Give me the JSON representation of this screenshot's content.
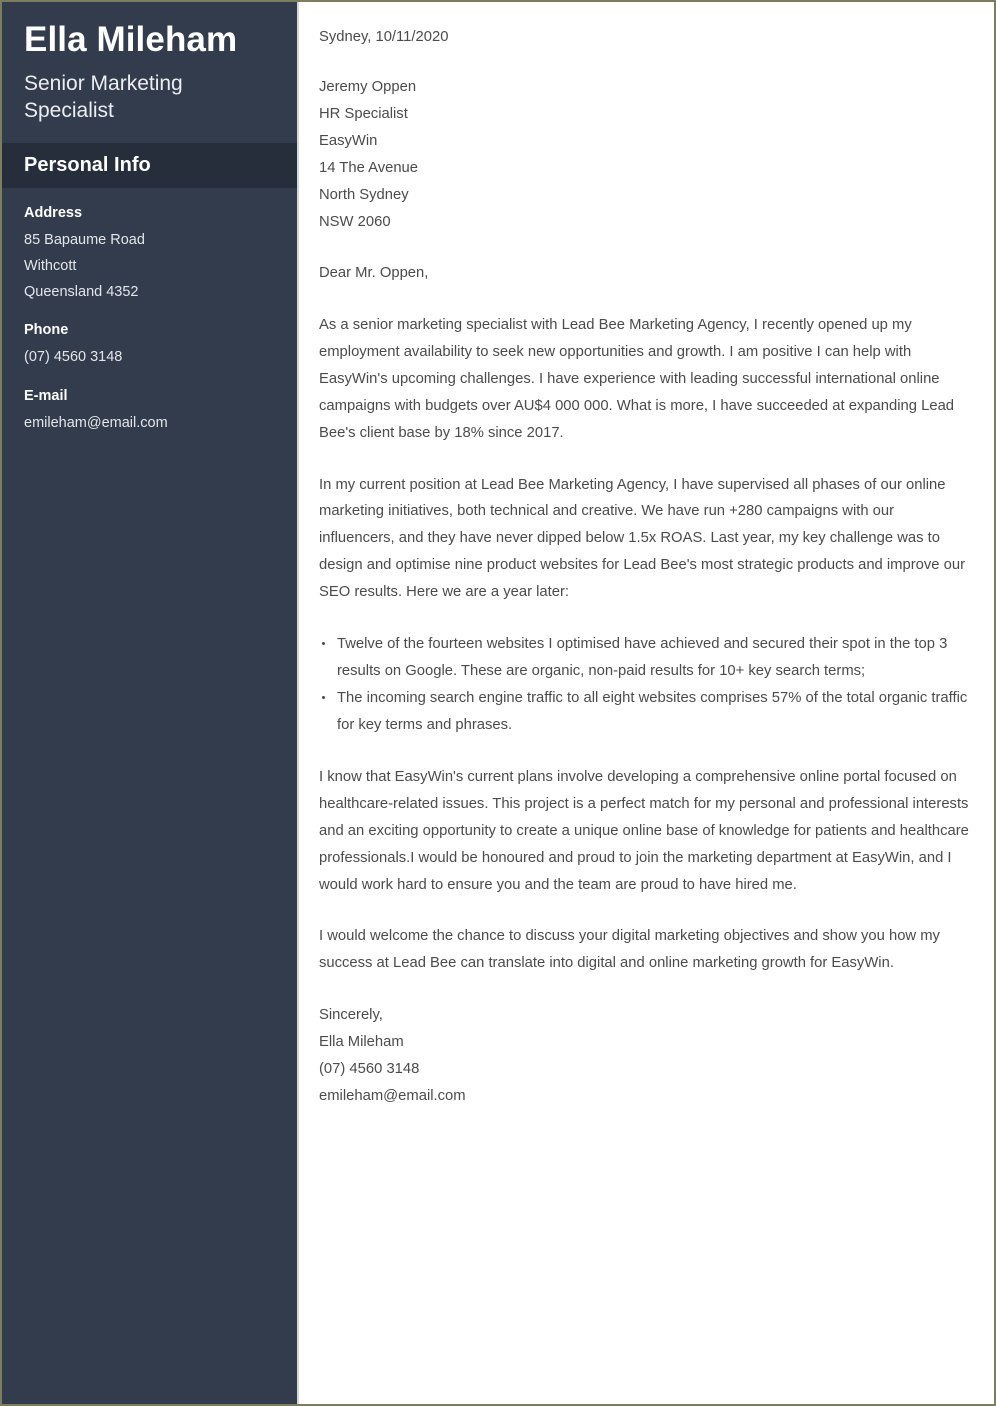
{
  "sidebar": {
    "full_name": "Ella Mileham",
    "job_title": "Senior Marketing Specialist",
    "section_title": "Personal Info",
    "info": [
      {
        "label": "Address",
        "lines": [
          "85 Bapaume Road",
          "Withcott",
          "Queensland 4352"
        ]
      },
      {
        "label": "Phone",
        "lines": [
          "(07) 4560 3148"
        ]
      },
      {
        "label": "E-mail",
        "lines": [
          "emileham@email.com"
        ]
      }
    ]
  },
  "letter": {
    "date": "Sydney, 10/11/2020",
    "recipient": [
      "Jeremy Oppen",
      "HR Specialist",
      "EasyWin",
      "14 The Avenue",
      "North Sydney",
      "NSW 2060"
    ],
    "salutation": "Dear Mr. Oppen,",
    "paragraph_1": "As a senior marketing specialist with Lead Bee Marketing Agency, I recently opened up my employment availability to seek new opportunities and growth. I am positive I can help with EasyWin's upcoming challenges. I have experience with leading successful international online campaigns with budgets over AU$4 000 000. What is more, I have succeeded at expanding Lead Bee's client base by 18% since 2017.",
    "paragraph_2": "In my current position at Lead Bee Marketing Agency, I have supervised all phases of our online marketing initiatives, both technical and creative. We have run +280 campaigns with our influencers, and they have never dipped below 1.5x ROAS. Last year, my key challenge was to design and optimise nine product websites for Lead Bee's most strategic products and improve our SEO results. Here we are a year later:",
    "bullets": [
      "Twelve of the fourteen websites I optimised have achieved and secured their spot in the top 3 results on Google. These are organic, non-paid results for 10+ key search terms;",
      "The incoming search engine traffic to all eight websites comprises 57% of the total organic traffic for key terms and phrases."
    ],
    "paragraph_3": "I know that EasyWin's current plans involve developing a comprehensive online portal focused on healthcare-related issues. This project is a perfect match for my personal and professional interests and an exciting opportunity to create a unique online base of knowledge for patients and healthcare professionals.I would be honoured and proud to join the marketing department at EasyWin, and I would work hard to ensure you and the team are proud to have hired me.",
    "paragraph_4": "I would welcome the chance to discuss your digital marketing objectives and show you how my success at Lead Bee can translate into digital and online marketing growth for EasyWin.",
    "signoff": [
      "Sincerely,",
      "Ella Mileham",
      "(07) 4560 3148",
      "emileham@email.com"
    ]
  },
  "colors": {
    "sidebar_bg": "#333c4d",
    "section_band_bg": "#262d3b",
    "page_border": "#7c7c5e",
    "body_text": "#4b4b4b",
    "sidebar_text": "#ffffff"
  }
}
